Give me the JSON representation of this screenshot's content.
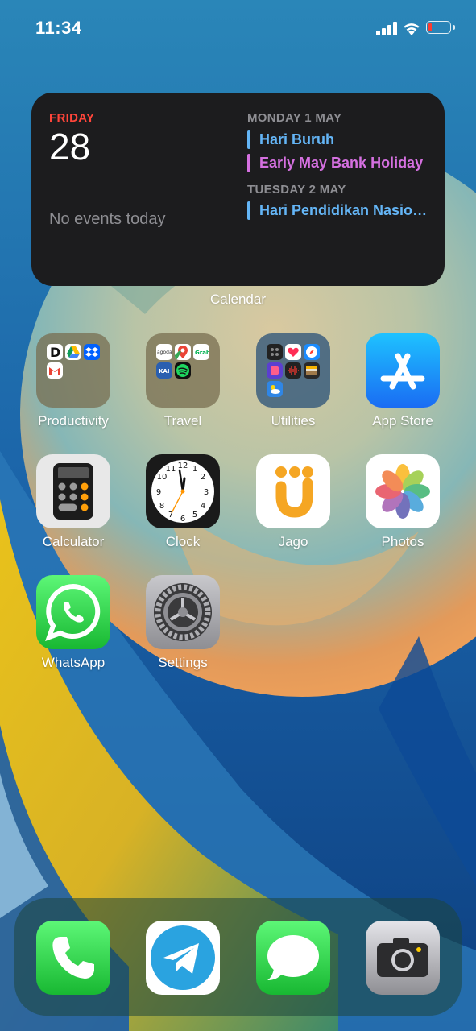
{
  "status_bar": {
    "time": "11:34"
  },
  "widget": {
    "day": "FRIDAY",
    "date": "28",
    "no_events": "No events today",
    "sections": [
      {
        "heading": "MONDAY 1 MAY",
        "events": [
          {
            "title": "Hari Buruh",
            "color": "#64b5f6"
          },
          {
            "title": "Early May Bank Holiday",
            "color": "#d570e0"
          }
        ]
      },
      {
        "heading": "TUESDAY 2 MAY",
        "events": [
          {
            "title": "Hari Pendidikan Nasional",
            "color": "#64b5f6"
          }
        ]
      }
    ],
    "label": "Calendar"
  },
  "apps": [
    {
      "label": "Productivity",
      "icon": "folder-icon"
    },
    {
      "label": "Travel",
      "icon": "folder-icon"
    },
    {
      "label": "Utilities",
      "icon": "folder-icon"
    },
    {
      "label": "App Store",
      "icon": "app-store-icon"
    },
    {
      "label": "Calculator",
      "icon": "calculator-icon"
    },
    {
      "label": "Clock",
      "icon": "clock-icon"
    },
    {
      "label": "Jago",
      "icon": "jago-icon"
    },
    {
      "label": "Photos",
      "icon": "photos-icon"
    },
    {
      "label": "WhatsApp",
      "icon": "whatsapp-icon"
    },
    {
      "label": "Settings",
      "icon": "settings-icon"
    }
  ],
  "folder_minis": {
    "travel_agoda": "agoda",
    "travel_grab": "Grab",
    "travel_kai": "KAI"
  },
  "dock": [
    {
      "name": "Phone",
      "icon": "phone-icon"
    },
    {
      "name": "Telegram",
      "icon": "telegram-icon"
    },
    {
      "name": "Messages",
      "icon": "messages-icon"
    },
    {
      "name": "Camera",
      "icon": "camera-icon"
    }
  ]
}
